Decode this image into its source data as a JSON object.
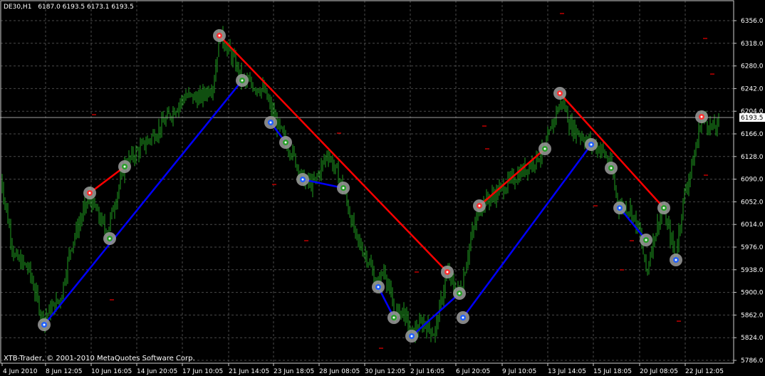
{
  "header": {
    "symbol": "DE30,H1",
    "ohlc": "6187.0 6193.5 6173.1 6193.5"
  },
  "footer": {
    "copyright": "XTB-Trader, © 2001-2010 MetaQuotes Software Corp."
  },
  "colors": {
    "background": "#000000",
    "grid": "#4a4a4a",
    "candles": "#1f9e1f",
    "bid_line": "#a0a0a0",
    "zigzag_up": "#0000ff",
    "zigzag_down": "#ff0000",
    "marker_ring": "#9c9c9c",
    "dash_marker": "#c00000"
  },
  "chart_data": {
    "type": "line",
    "grid": true,
    "ylim": [
      5786,
      6380
    ],
    "y_ticks": [
      "6356.0",
      "6318.0",
      "6280.0",
      "6242.0",
      "6204.0",
      "6166.0",
      "6128.0",
      "6090.0",
      "6052.0",
      "6014.0",
      "5976.0",
      "5938.0",
      "5900.0",
      "5862.0",
      "5824.0",
      "5786.0"
    ],
    "current_price": "6193.5",
    "x_ticks": [
      "4 Jun 2010",
      "8 Jun 12:05",
      "10 Jun 16:05",
      "14 Jun 20:05",
      "17 Jun 10:05",
      "21 Jun 14:05",
      "23 Jun 18:05",
      "28 Jun 08:05",
      "30 Jun 12:05",
      "2 Jul 16:05",
      "6 Jul 20:05",
      "9 Jul 10:05",
      "13 Jul 14:05",
      "15 Jul 18:05",
      "20 Jul 08:05",
      "22 Jul 12:05"
    ],
    "price_series": {
      "name": "",
      "anchors": [
        [
          0,
          6100
        ],
        [
          20,
          5960
        ],
        [
          40,
          5940
        ],
        [
          60,
          5855
        ],
        [
          85,
          5890
        ],
        [
          100,
          5980
        ],
        [
          125,
          6060
        ],
        [
          150,
          6000
        ],
        [
          175,
          6115
        ],
        [
          200,
          6145
        ],
        [
          220,
          6170
        ],
        [
          240,
          6200
        ],
        [
          260,
          6230
        ],
        [
          280,
          6225
        ],
        [
          300,
          6250
        ],
        [
          308,
          6335
        ],
        [
          330,
          6285
        ],
        [
          340,
          6255
        ],
        [
          370,
          6240
        ],
        [
          390,
          6180
        ],
        [
          402,
          6150
        ],
        [
          410,
          6135
        ],
        [
          425,
          6090
        ],
        [
          440,
          6080
        ],
        [
          460,
          6135
        ],
        [
          482,
          6075
        ],
        [
          500,
          5990
        ],
        [
          515,
          5960
        ],
        [
          530,
          5910
        ],
        [
          540,
          5940
        ],
        [
          553,
          5865
        ],
        [
          565,
          5870
        ],
        [
          578,
          5830
        ],
        [
          595,
          5850
        ],
        [
          610,
          5830
        ],
        [
          628,
          5935
        ],
        [
          640,
          5900
        ],
        [
          648,
          5910
        ],
        [
          660,
          5985
        ],
        [
          675,
          6048
        ],
        [
          690,
          6060
        ],
        [
          705,
          6075
        ],
        [
          720,
          6090
        ],
        [
          740,
          6110
        ],
        [
          765,
          6140
        ],
        [
          780,
          6200
        ],
        [
          790,
          6225
        ],
        [
          800,
          6180
        ],
        [
          815,
          6165
        ],
        [
          828,
          6150
        ],
        [
          845,
          6140
        ],
        [
          858,
          6110
        ],
        [
          868,
          6045
        ],
        [
          885,
          6040
        ],
        [
          898,
          6000
        ],
        [
          908,
          5930
        ],
        [
          915,
          5980
        ],
        [
          930,
          6040
        ],
        [
          940,
          6000
        ],
        [
          948,
          5960
        ],
        [
          960,
          6060
        ],
        [
          975,
          6130
        ],
        [
          985,
          6195
        ],
        [
          1000,
          6175
        ],
        [
          1010,
          6180
        ]
      ]
    },
    "zigzag_lines": [
      {
        "color": "blue",
        "points": [
          [
            "8 Jun",
            5855
          ],
          [
            "21 Jun",
            6260
          ]
        ]
      },
      {
        "color": "red",
        "points": [
          [
            "17 Jun",
            6340
          ],
          [
            "2 Jul",
            5940
          ]
        ]
      },
      {
        "color": "blue",
        "points": [
          [
            "2 Jul",
            5828
          ],
          [
            "6 Jul",
            5903
          ]
        ]
      },
      {
        "color": "blue",
        "points": [
          [
            "6 Jul",
            5866
          ],
          [
            "15 Jul",
            6150
          ]
        ]
      },
      {
        "color": "red",
        "points": [
          [
            "6 Jul",
            6048
          ],
          [
            "13 Jul",
            6145
          ]
        ]
      },
      {
        "color": "red",
        "points": [
          [
            "13 Jul",
            6238
          ],
          [
            "20 Jul",
            6045
          ]
        ]
      },
      {
        "color": "red",
        "points": [
          [
            "10 Jun",
            6072
          ],
          [
            "10 Jun",
            6114
          ]
        ]
      },
      {
        "color": "blue",
        "points": [
          [
            "23 Jun",
            6190
          ],
          [
            "23 Jun",
            6155
          ]
        ]
      },
      {
        "color": "blue",
        "points": [
          [
            "23 Jun",
            6094
          ],
          [
            "28 Jun",
            6080
          ]
        ]
      },
      {
        "color": "blue",
        "points": [
          [
            "30 Jun",
            5910
          ],
          [
            "30 Jun",
            5866
          ]
        ]
      },
      {
        "color": "blue",
        "points": [
          [
            "15 Jul",
            6045
          ],
          [
            "20 Jul",
            5999
          ]
        ]
      }
    ]
  }
}
